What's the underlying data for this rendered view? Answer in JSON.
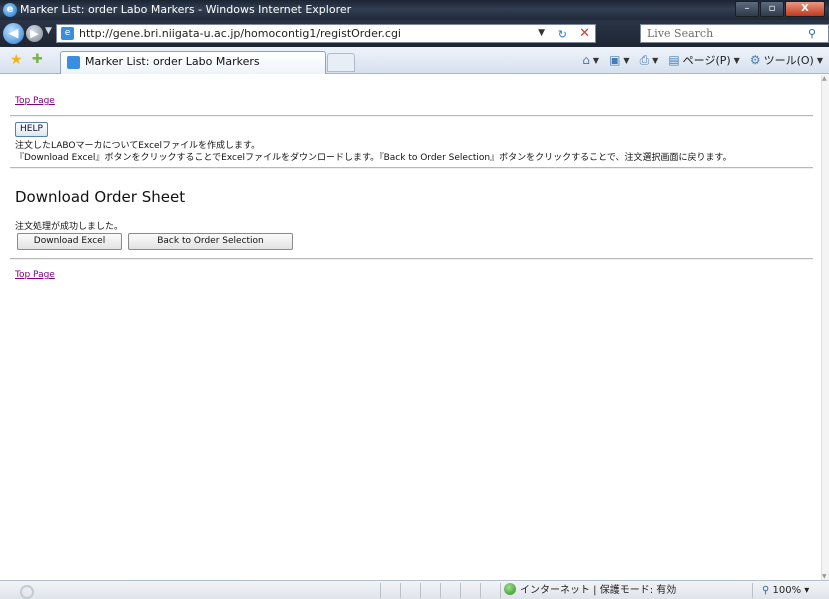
{
  "window": {
    "title": "Marker List: order Labo Markers - Windows Internet Explorer",
    "minimize": "–",
    "maximize": "▫",
    "close": "X"
  },
  "address_bar": {
    "url": "http://gene.bri.niigata-u.ac.jp/homocontig1/registOrder.cgi",
    "search_placeholder": "Live Search"
  },
  "tab": {
    "label": "Marker List: order Labo Markers"
  },
  "command_bar": {
    "page_menu": "ページ(P)",
    "tools_menu": "ツール(O)"
  },
  "content": {
    "top_link": "Top Page",
    "help_button": "HELP",
    "description_line1": "注文したLABOマーカについてExcelファイルを作成します。",
    "description_line2": "『Download Excel』ボタンをクリックすることでExcelファイルをダウンロードします。『Back to Order Selection』ボタンをクリックすることで、注文選択画面に戻ります。",
    "heading": "Download Order Sheet",
    "status_message": "注文処理が成功しました。",
    "download_button": "Download Excel",
    "back_button": "Back to Order Selection",
    "bottom_link": "Top Page"
  },
  "status_bar": {
    "zone_text": "インターネット | 保護モード: 有効",
    "zoom": "100%"
  }
}
